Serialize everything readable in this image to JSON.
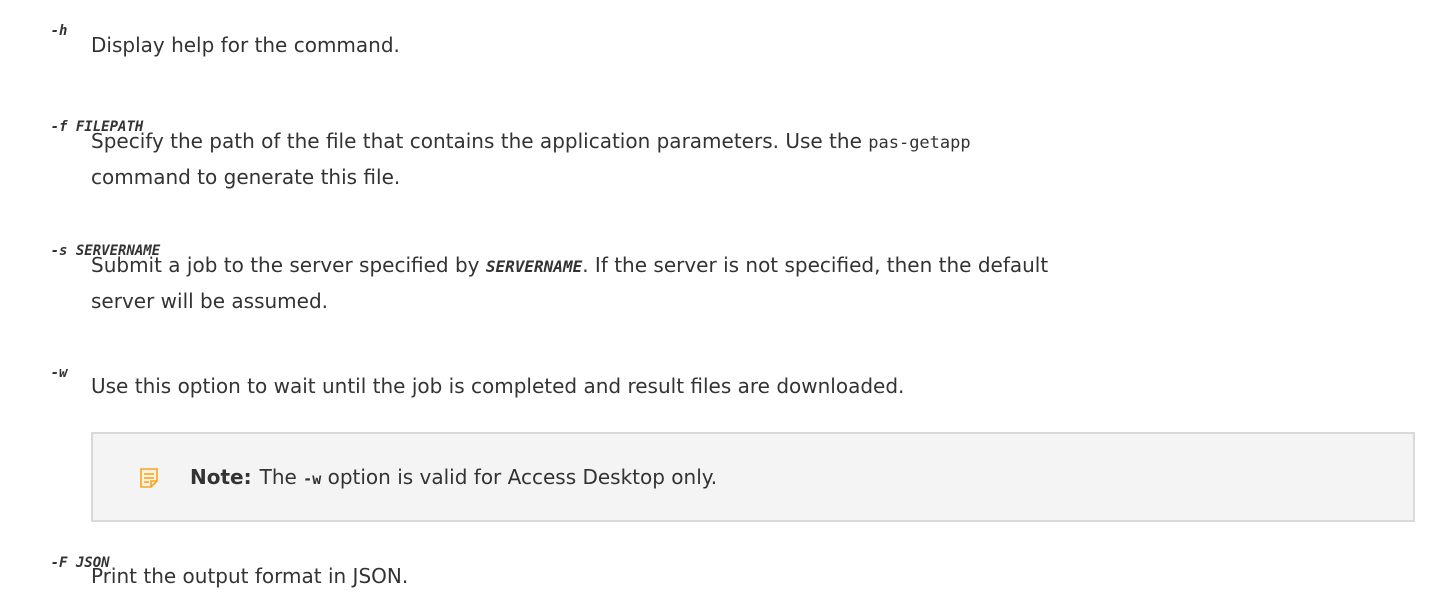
{
  "options": [
    {
      "flag": "-h",
      "arg": "",
      "description": "Display help for the command."
    },
    {
      "flag": "-f",
      "arg": "FILEPATH",
      "description_before": "Specify the path of the file that contains the application parameters. Use the ",
      "description_code": "pas-getapp",
      "description_line2": "command to generate this file."
    },
    {
      "flag": "-s",
      "arg": "SERVERNAME",
      "description_before": "Submit a job to the server specified by ",
      "description_var": "SERVERNAME",
      "description_after": ". If the server is not specified, then the default",
      "description_line2": "server will be assumed."
    },
    {
      "flag": "-w",
      "arg": "",
      "description": "Use this option to wait until the job is completed and result files are downloaded."
    },
    {
      "flag": "-F",
      "arg": "JSON",
      "description": "Print the output format in JSON."
    }
  ],
  "note": {
    "label": "Note:",
    "text_before": "The ",
    "code": "-w",
    "text_after": " option is valid for Access Desktop only.",
    "icon": "note-icon",
    "icon_color": "#f5a623"
  },
  "colors": {
    "text": "#333333",
    "note_background": "#f4f4f4",
    "note_border": "#d9d9d9"
  }
}
